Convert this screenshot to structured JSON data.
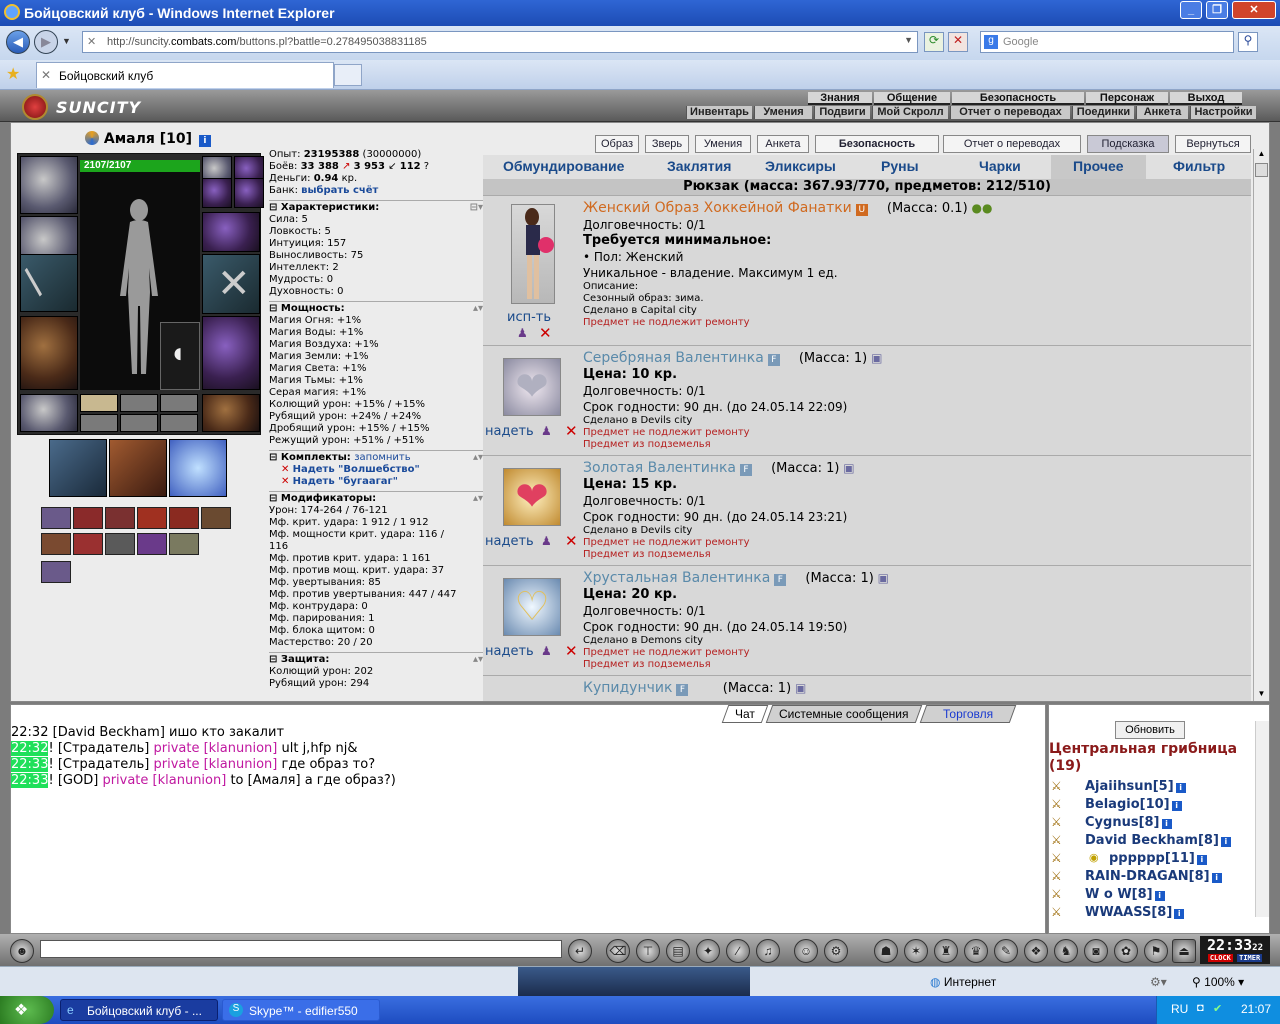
{
  "window": {
    "title": "Бойцовский клуб - Windows Internet Explorer",
    "url_prefix": "http://suncity.",
    "url_domain": "combats.com",
    "url_suffix": "/buttons.pl?battle=0.278495038831185",
    "search_placeholder": "Google",
    "tab_title": "Бойцовский клуб"
  },
  "game": {
    "logo": "SUNCITY",
    "menu_top": [
      "Знания",
      "Общение",
      "Безопасность",
      "Персонаж",
      "Выход"
    ],
    "menu_sub": [
      "Инвентарь",
      "Умения",
      "Подвиги",
      "Мой Скролл",
      "Отчет о переводах",
      "Поединки",
      "Анкета",
      "Настройки"
    ]
  },
  "character": {
    "name": "Амаля [10]",
    "hp": "2107/2107"
  },
  "stats": {
    "exp_label": "Опыт:",
    "exp": "23195388",
    "exp_next": "(30000000)",
    "fights_label": "Боёв:",
    "fights_w": "33 388",
    "fights_l": "3 953",
    "fights_d": "112",
    "money_label": "Деньги:",
    "money": "0.94",
    "money_unit": "кр.",
    "bank_label": "Банк:",
    "bank_link": "выбрать счёт",
    "char_header": "Характеристики:",
    "char": [
      "Сила: 5",
      "Ловкость: 5",
      "Интуиция: 157",
      "Выносливость: 75",
      "Интеллект: 2",
      "Мудрость: 0",
      "Духовность: 0"
    ],
    "power_header": "Мощность:",
    "power": [
      "Магия Огня: +1%",
      "Магия Воды: +1%",
      "Магия Воздуха: +1%",
      "Магия Земли: +1%",
      "Магия Света: +1%",
      "Магия Тьмы: +1%",
      "Серая магия: +1%",
      "Колющий урон: +15% / +15%",
      "Рубящий урон: +24% / +24%",
      "Дробящий урон: +15% / +15%",
      "Режущий урон: +51% / +51%"
    ],
    "sets_header": "Комплекты:",
    "sets_remember": "запомнить",
    "sets": [
      "Надеть \"Волшебство\"",
      "Надеть \"бугаагаг\""
    ],
    "mod_header": "Модификаторы:",
    "mods": [
      "Урон: 174-264 / 76-121",
      "Мф. крит. удара: 1 912 / 1 912",
      "Мф. мощности крит. удара: 116 /",
      "116",
      "Мф. против крит. удара: 1 161",
      "Мф. против мощ. крит. удара: 37",
      "Мф. увертывания: 85",
      "Мф. против увертывания: 447 / 447",
      "Мф. контрудара: 0",
      "Мф. парирования: 1",
      "Мф. блока щитом: 0",
      "Мастерство: 20 / 20"
    ],
    "def_header": "Защита:",
    "def": [
      "Колющий урон: 202",
      "Рубящий урон: 294"
    ]
  },
  "toolbar": [
    "Образ",
    "Зверь",
    "Умения",
    "Анкета",
    "Безопасность",
    "Отчет о переводах",
    "Подсказка",
    "Вернуться"
  ],
  "categories": [
    "Обмундирование",
    "Заклятия",
    "Эликсиры",
    "Руны",
    "Чарки",
    "Прочее",
    "Фильтр"
  ],
  "backpack": "Рюкзак (масса: 367.93/770, предметов: 212/510)",
  "items": [
    {
      "name": "Женский Образ Хоккейной Фанатки",
      "badge": "U",
      "mass": "(Масса: 0.1)",
      "action": "исп-ть",
      "lines": [
        "Долговечность: 0/1"
      ],
      "bold": "Требуется минимальное:",
      "req": "• Пол: Женский",
      "unique": "Уникальное - владение. Максимум 1 ед.",
      "small": [
        "Описание:",
        "Сезонный образ: зима.",
        "Сделано в Capital city"
      ],
      "red": [
        "Предмет не подлежит ремонту"
      ]
    },
    {
      "name": "Серебряная Валентинка",
      "badge": "F",
      "mass": "(Масса: 1)",
      "action": "надеть",
      "price": "Цена: 10 кр.",
      "lines": [
        "Долговечность: 0/1",
        "Срок годности: 90 дн. (до 24.05.14 22:09)"
      ],
      "small": [
        "Сделано в Devils city"
      ],
      "red": [
        "Предмет не подлежит ремонту",
        "Предмет из подземелья"
      ]
    },
    {
      "name": "Золотая Валентинка",
      "badge": "F",
      "mass": "(Масса: 1)",
      "action": "надеть",
      "price": "Цена: 15 кр.",
      "lines": [
        "Долговечность: 0/1",
        "Срок годности: 90 дн. (до 24.05.14 23:21)"
      ],
      "small": [
        "Сделано в Devils city"
      ],
      "red": [
        "Предмет не подлежит ремонту",
        "Предмет из подземелья"
      ]
    },
    {
      "name": "Хрустальная Валентинка",
      "badge": "F",
      "mass": "(Масса: 1)",
      "action": "надеть",
      "price": "Цена: 20 кр.",
      "lines": [
        "Долговечность: 0/1",
        "Срок годности: 90 дн. (до 24.05.14 19:50)"
      ],
      "small": [
        "Сделано в Demons city"
      ],
      "red": [
        "Предмет не подлежит ремонту",
        "Предмет из подземелья"
      ]
    },
    {
      "name": "Купидунчик",
      "badge": "F",
      "mass": "(Масса: 1)"
    }
  ],
  "chat": {
    "tabs": [
      "Чат",
      "Системные сообщения",
      "Торговля"
    ],
    "lines": [
      {
        "time": "22:32",
        "pre": " [",
        "nick": "David Beckham",
        "mid": "] ",
        "priv": "",
        "text": "ишо кто закалит"
      },
      {
        "time": "22:32",
        "pre": "! [",
        "nick": "Страдатель",
        "mid": "] ",
        "priv": "private [klanunion]",
        "text": " ult j,hfp nj&"
      },
      {
        "time": "22:33",
        "pre": "! [",
        "nick": "Страдатель",
        "mid": "] ",
        "priv": "private [klanunion]",
        "text": " где образ то?"
      },
      {
        "time": "22:33",
        "pre": "! [",
        "nick": "GOD",
        "mid": "] ",
        "priv": "private [klanunion]",
        "text": " to [Амаля] а где образ?)"
      }
    ]
  },
  "online": {
    "refresh": "Обновить",
    "location": "Центральная грибница",
    "count": "(19)",
    "users": [
      "Ajaiihsun[5]",
      "Belagio[10]",
      "Cygnus[8]",
      "David Beckham[8]",
      "pppppp[11]",
      "RAIN-DRAGAN[8]",
      "W o W[8]",
      "WWAASS[8]"
    ]
  },
  "clock": {
    "time": "22:33",
    "sec": "22",
    "labels": [
      "CLOCK",
      "TIMER"
    ]
  },
  "status": {
    "zone": "Интернет",
    "zoom": "100%"
  },
  "taskbar": {
    "tasks": [
      "Бойцовский клуб - ...",
      "Skype™ - edifier550"
    ],
    "lang": "RU",
    "time": "21:07"
  }
}
